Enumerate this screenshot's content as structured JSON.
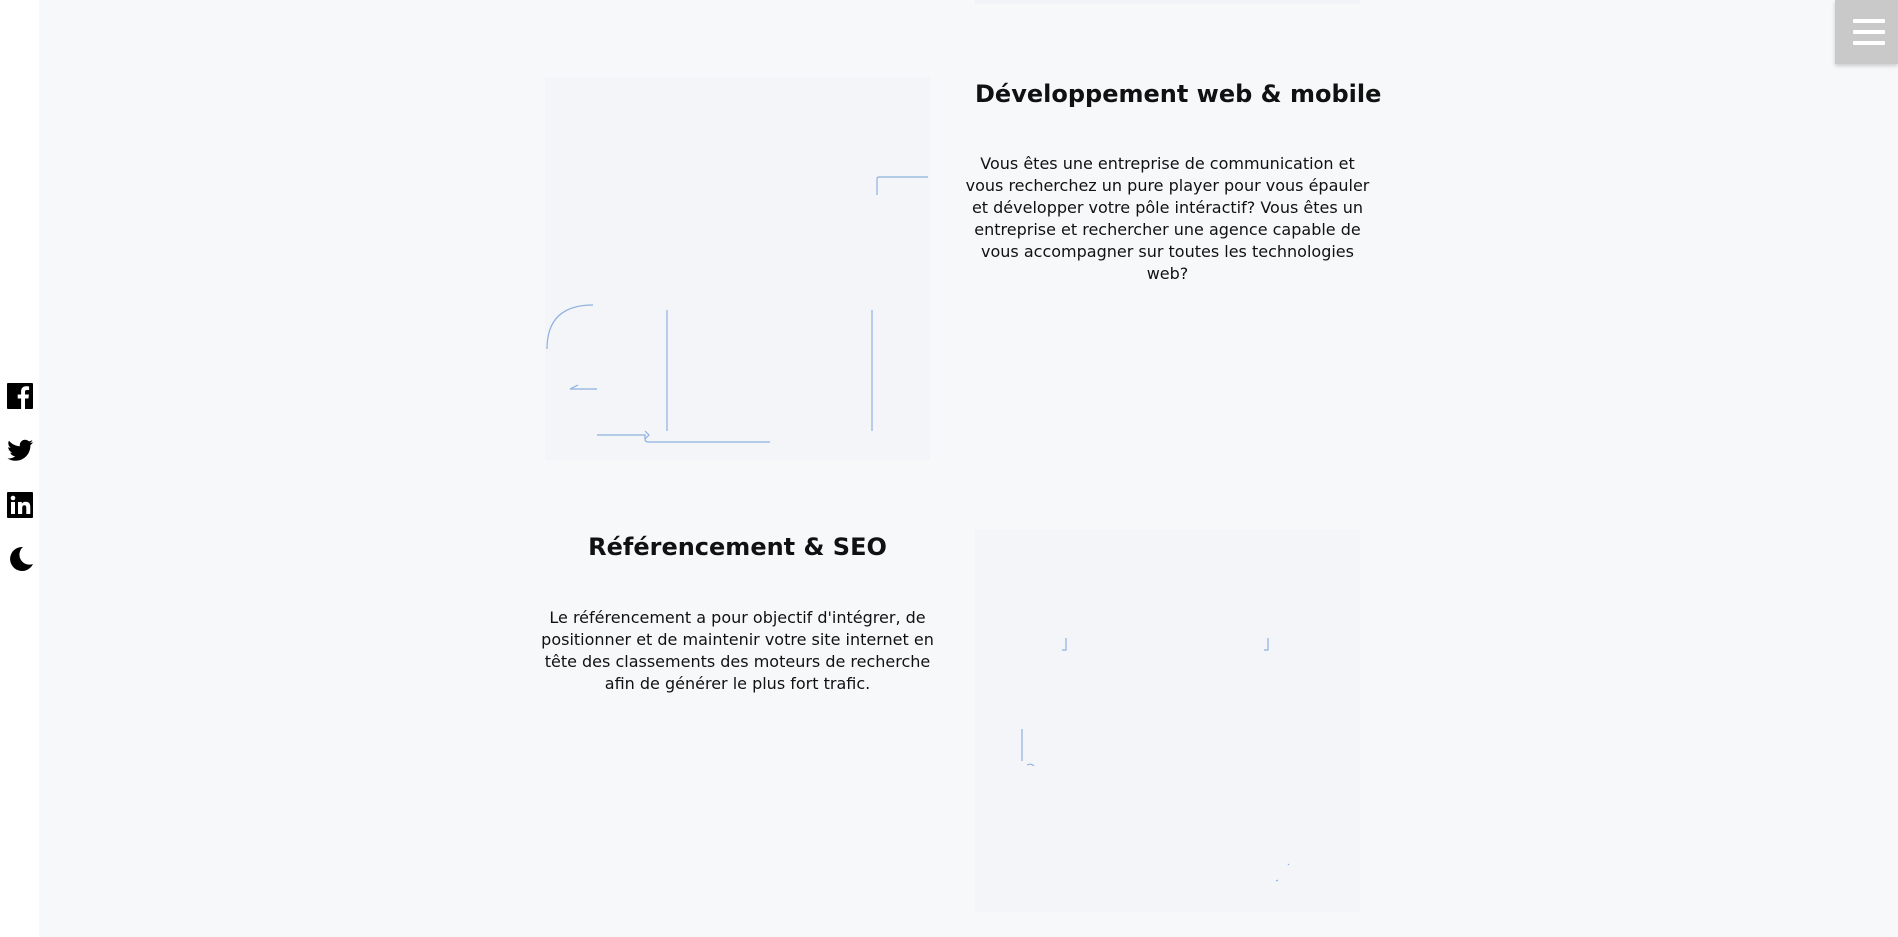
{
  "social": [
    {
      "name": "facebook",
      "icon": "facebook-icon"
    },
    {
      "name": "twitter",
      "icon": "twitter-icon"
    },
    {
      "name": "linkedin",
      "icon": "linkedin-icon"
    },
    {
      "name": "dark-mode",
      "icon": "moon-icon"
    }
  ],
  "menu": {
    "icon": "hamburger-menu-icon"
  },
  "services": [
    {
      "title": "Développement web & mobile",
      "text": "Vous êtes une entreprise de communication et vous recherchez un pure player pour vous épauler et développer votre pôle intéractif? Vous êtes un entreprise et rechercher une agence capable de vous accompagner sur toutes les technologies web?"
    },
    {
      "title": "Référencement & SEO",
      "text": "Le référencement a pour objectif d'intégrer, de positionner et de maintenir votre site internet en tête des classements des moteurs de recherche afin de générer le plus fort trafic."
    }
  ],
  "colors": {
    "background": "#f7f8fa",
    "illustration_line": "#8fb0e0",
    "menu_button": "#c8c9c8"
  }
}
